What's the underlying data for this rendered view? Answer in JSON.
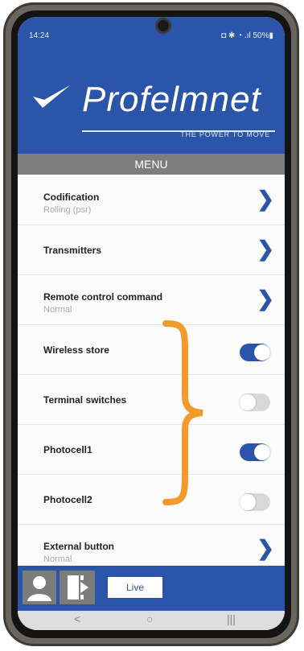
{
  "status": {
    "time": "14:24",
    "system_icons": "◘ ✱ ◔ .ıl 50%▮"
  },
  "header": {
    "logo_text": "Profelmnet",
    "tagline": "THE POWER TO MOVE"
  },
  "menu": {
    "title": "MENU"
  },
  "items": [
    {
      "label": "Codification",
      "sub": "Rolling (psr)",
      "control": "chevron"
    },
    {
      "label": "Transmitters",
      "sub": "",
      "control": "chevron"
    },
    {
      "label": "Remote control command",
      "sub": "Normal",
      "control": "chevron"
    },
    {
      "label": "Wireless store",
      "sub": "",
      "control": "toggle",
      "on": true
    },
    {
      "label": "Terminal switches",
      "sub": "",
      "control": "toggle",
      "on": false
    },
    {
      "label": "Photocell1",
      "sub": "",
      "control": "toggle",
      "on": true
    },
    {
      "label": "Photocell2",
      "sub": "",
      "control": "toggle",
      "on": false
    },
    {
      "label": "External button",
      "sub": "Normal",
      "control": "chevron"
    }
  ],
  "bottom": {
    "live_label": "Live"
  },
  "nav": {
    "back": "<",
    "home": "○",
    "recents": "|||"
  },
  "colors": {
    "brand_blue": "#2b55a8",
    "annotation_orange": "#f39a2c",
    "menu_gray": "#7d7d7d"
  }
}
